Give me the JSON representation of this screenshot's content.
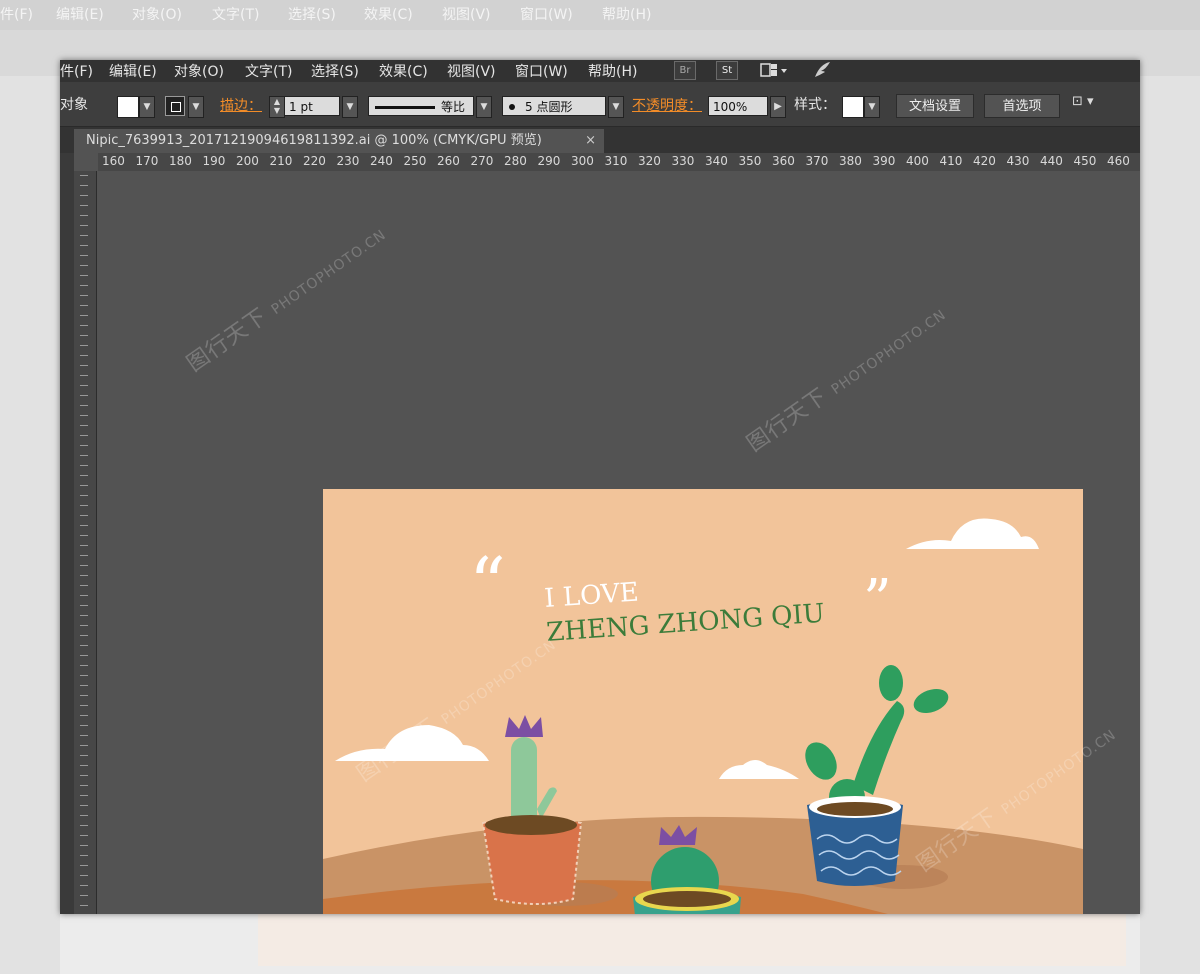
{
  "menu": {
    "items": [
      "件(F)",
      "编辑(E)",
      "对象(O)",
      "文字(T)",
      "选择(S)",
      "效果(C)",
      "视图(V)",
      "窗口(W)",
      "帮助(H)"
    ],
    "bridge_label": "Br",
    "stock_label": "St"
  },
  "control_bar": {
    "selection_label": "对象",
    "stroke_label": "描边：",
    "stroke_value": "1 pt",
    "stroke_profile_label": "等比",
    "brush_label": "5 点圆形",
    "opacity_label": "不透明度：",
    "opacity_value": "100%",
    "style_label": "样式：",
    "doc_setup_button": "文档设置",
    "preferences_button": "首选项"
  },
  "document_tab": {
    "title": "Nipic_7639913_20171219094619811392.ai  @  100%  (CMYK/GPU 预览)",
    "close": "×"
  },
  "ruler": {
    "h_ticks": [
      "160",
      "170",
      "180",
      "190",
      "200",
      "210",
      "220",
      "230",
      "240",
      "250",
      "260",
      "270",
      "280",
      "290",
      "300",
      "310",
      "320",
      "330",
      "340",
      "350",
      "360",
      "370",
      "380",
      "390",
      "400",
      "410",
      "420",
      "430",
      "440",
      "450",
      "460"
    ]
  },
  "artwork": {
    "line1": "I LOVE",
    "line2": "ZHENG ZHONG QIU",
    "open_quote": "“",
    "close_quote": "”",
    "colors": {
      "sky": "#f2c49a",
      "hill_back": "#c99366",
      "ground": "#c9793f",
      "cactus_green": "#2e9e5e",
      "text_green": "#3c7c3a"
    }
  },
  "watermark": {
    "logo_text": "图行天下",
    "url_text": "PHOTOPHOTO.CN"
  }
}
